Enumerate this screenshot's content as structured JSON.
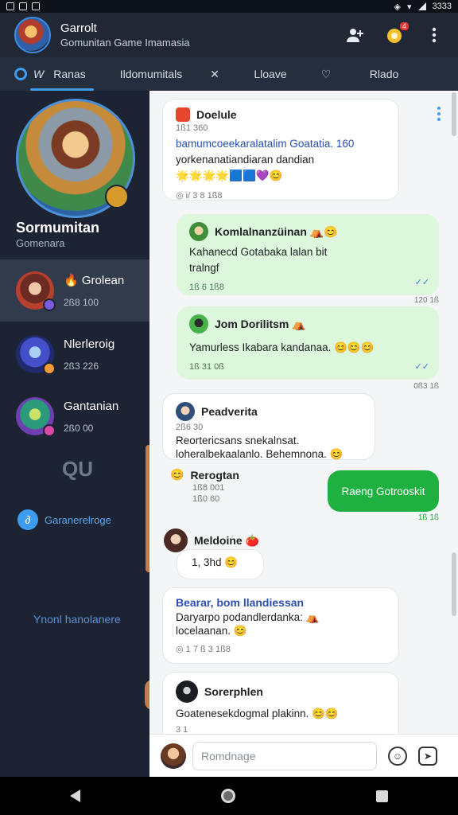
{
  "status_bar": {
    "time": "3333"
  },
  "header": {
    "title": "Garrolt",
    "subtitle": "Gomunitan Game Imamasia",
    "notification_count": "4"
  },
  "tabs": [
    {
      "prefix": "W",
      "label": "Ranas"
    },
    {
      "label": "Ildomumitals"
    },
    {
      "label": "✕"
    },
    {
      "label": "Lloave"
    },
    {
      "label": "♡"
    },
    {
      "label": "Rlado"
    }
  ],
  "sidebar": {
    "profile_name": "Sormumitan",
    "profile_sub": "Gomenara",
    "chats": [
      {
        "name": "Grolean",
        "time": "2ß8 100"
      },
      {
        "name": "Nlerleroig",
        "time": "2ß3 226"
      },
      {
        "name": "Gantanian",
        "time": "2ß0 00"
      }
    ],
    "logo_text": "QU",
    "link_label": "Garanerelroge",
    "footer_text": "Ynonl hanolanere"
  },
  "messages": [
    {
      "name": "Doelule",
      "sub": "1ß1 360",
      "line1": "bamumcoeekaralatalim Goatatia. 160",
      "line2": "yorkenanatiandiaran dandian",
      "emoji": "🌟🌟🌟🌟🟦🟦💜😊",
      "time": "i/ 3 8 1ß8"
    },
    {
      "name": "Komlalnanzüinan ⛺😊",
      "line1": "Kahanecd Gotabaka lalan bit",
      "line2": "tralngf",
      "time": "1ß 6 1ß8",
      "outside_time": "120 1ß"
    },
    {
      "name": "Jom Dorilitsm ⛺",
      "line1": "Yamurless Ikabara kandanaa. 😊😊😊",
      "time": "1ß 31 0ß",
      "outside_time": "0ß3 1ß"
    },
    {
      "name": "Peadverita",
      "sub": "2ß6 30",
      "line1": "Reortericsans snekalnsat.",
      "line2": "loheralbekaalanlo. Behemnona. 😊"
    },
    {
      "name": "Rerogtan",
      "sub": "1ß8 001",
      "line2": "1ß0 60"
    },
    {
      "text": "Raeng Gotrooskit",
      "time": "1ß 1ß"
    },
    {
      "name": "Meldoine 🍅",
      "line1": "1, 3hd 😊"
    },
    {
      "name": "Bearar, bom llandiessan",
      "line1": "Daryarpo podandlerdanka: ⛺",
      "line2": "locelaanan. 😊",
      "time": "1 7 ß 3 1ß8"
    },
    {
      "name": "Sorerphlen",
      "line1": "Goatenesekdogmal plakinn. 😊😊",
      "line2": "3 1"
    }
  ],
  "composer": {
    "placeholder": "Romdnage"
  }
}
